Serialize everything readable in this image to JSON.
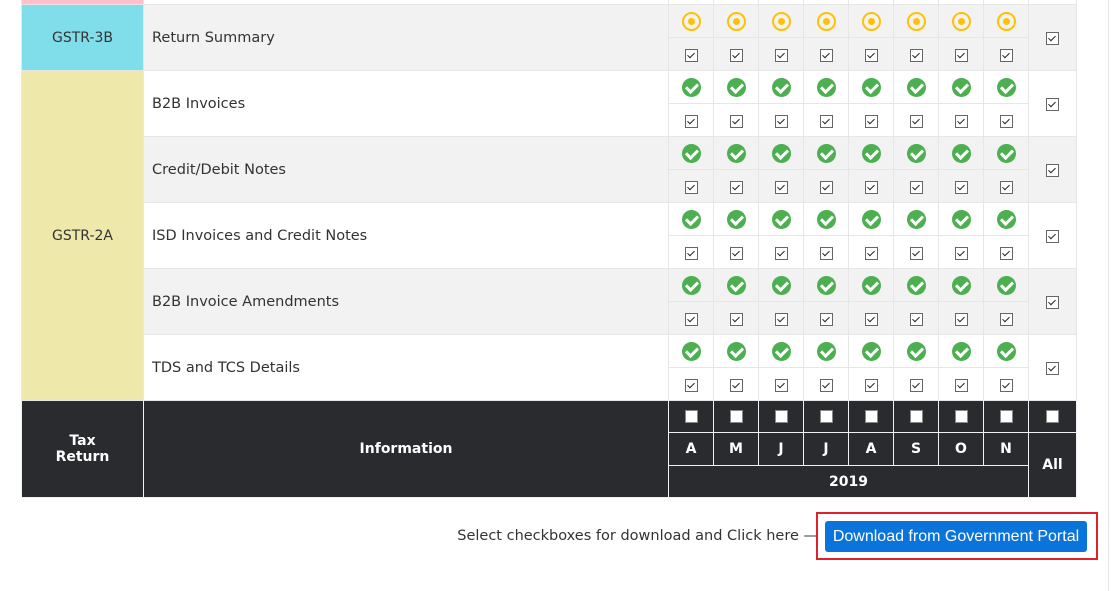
{
  "groups": [
    {
      "return": "GSTR-3B",
      "color": "#80deea",
      "rows": [
        {
          "info": "Return Summary",
          "status": "pending",
          "all_checked": true
        }
      ]
    },
    {
      "return": "GSTR-2A",
      "color": "#eee8aa",
      "rows": [
        {
          "info": "B2B Invoices",
          "status": "complete",
          "all_checked": true
        },
        {
          "info": "Credit/Debit Notes",
          "status": "complete",
          "all_checked": true
        },
        {
          "info": "ISD Invoices and Credit Notes",
          "status": "complete",
          "all_checked": true
        },
        {
          "info": "B2B Invoice Amendments",
          "status": "complete",
          "all_checked": true
        },
        {
          "info": "TDS and TCS Details",
          "status": "complete",
          "all_checked": true
        }
      ]
    }
  ],
  "status_icons": {
    "pending": "pending-circle-icon",
    "complete": "check-circle-icon"
  },
  "status_colors": {
    "pending": "#ffc107",
    "complete": "#4caf50"
  },
  "header": {
    "tax_return_line1": "Tax",
    "tax_return_line2": "Return",
    "information": "Information",
    "months": [
      "A",
      "M",
      "J",
      "J",
      "A",
      "S",
      "O",
      "N"
    ],
    "year": "2019",
    "all": "All"
  },
  "footer": {
    "instruction": "Select checkboxes for download and Click here —",
    "download_button": "Download from Government Portal",
    "button_color": "#0a74da",
    "highlight_color": "#e0202c"
  }
}
